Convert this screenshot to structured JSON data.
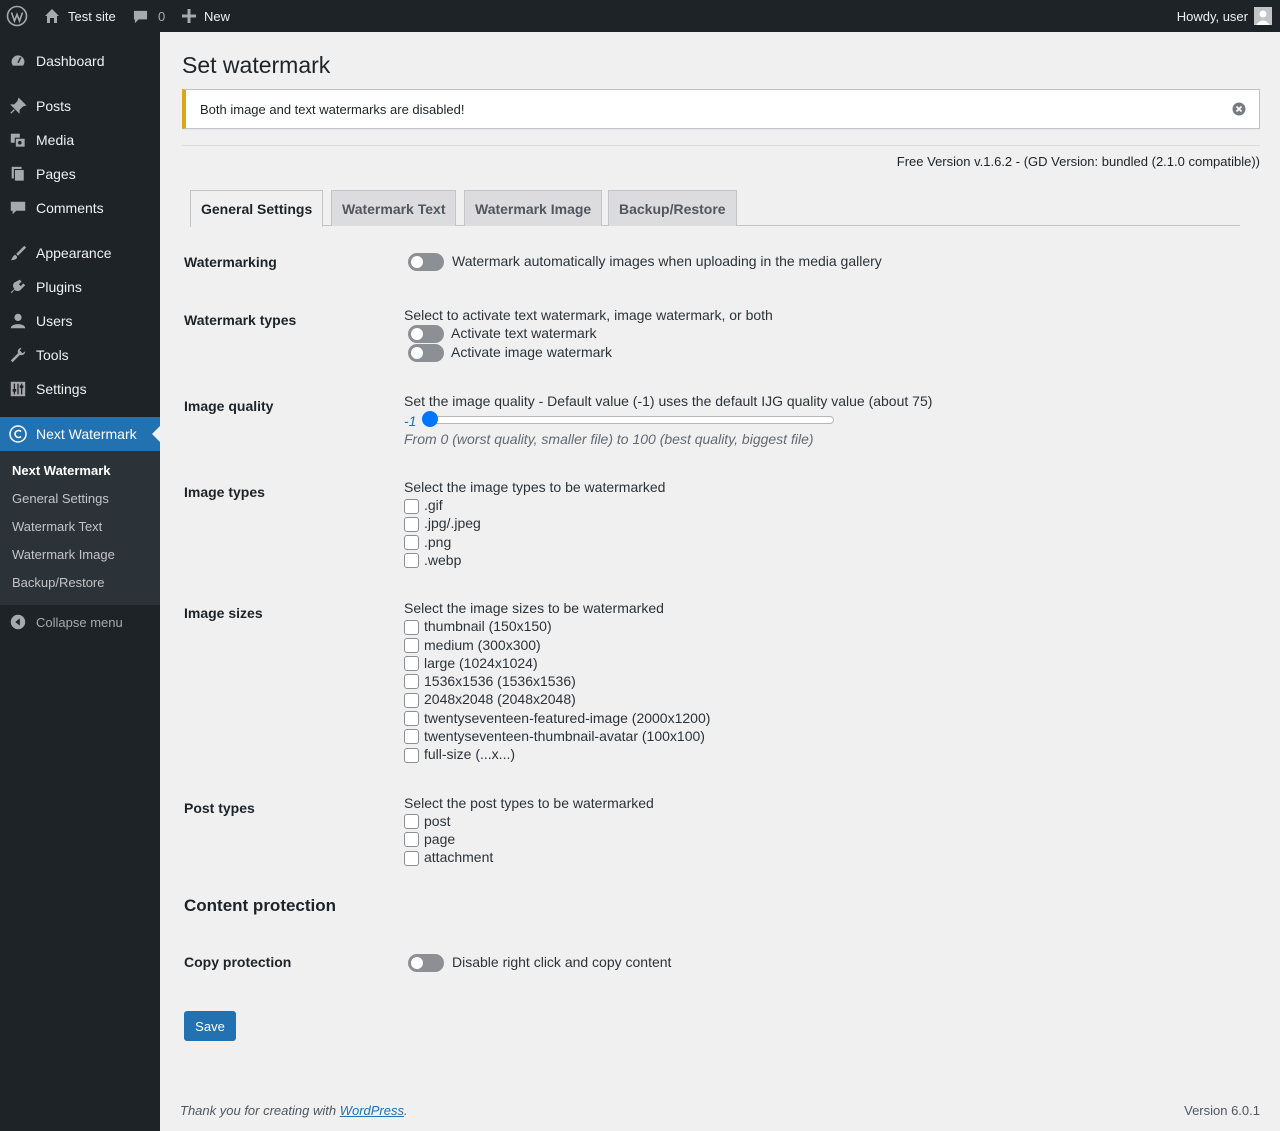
{
  "admin_bar": {
    "site_name": "Test site",
    "comments_count": "0",
    "new_label": "New",
    "howdy": "Howdy, user",
    "icons": [
      "wordpress-logo-icon",
      "home-icon",
      "comment-icon",
      "plus-icon",
      "avatar"
    ]
  },
  "sidebar": {
    "items": [
      {
        "label": "Dashboard",
        "icon": "dashboard-icon"
      },
      {
        "label": "Posts",
        "icon": "pin-icon"
      },
      {
        "label": "Media",
        "icon": "media-icon"
      },
      {
        "label": "Pages",
        "icon": "pages-icon"
      },
      {
        "label": "Comments",
        "icon": "comment-icon"
      },
      {
        "label": "Appearance",
        "icon": "brush-icon"
      },
      {
        "label": "Plugins",
        "icon": "plug-icon"
      },
      {
        "label": "Users",
        "icon": "user-icon"
      },
      {
        "label": "Tools",
        "icon": "wrench-icon"
      },
      {
        "label": "Settings",
        "icon": "sliders-icon"
      },
      {
        "label": "Next Watermark",
        "icon": "copyright-icon"
      }
    ],
    "submenu": [
      "Next Watermark",
      "General Settings",
      "Watermark Text",
      "Watermark Image",
      "Backup/Restore"
    ],
    "collapse_label": "Collapse menu"
  },
  "page": {
    "title": "Set watermark",
    "notice": "Both image and text watermarks are disabled!",
    "version_line": "Free Version v.1.6.2 - (GD Version: bundled (2.1.0 compatible))",
    "tabs": [
      "General Settings",
      "Watermark Text",
      "Watermark Image",
      "Backup/Restore"
    ],
    "active_tab": "General Settings"
  },
  "form": {
    "watermarking": {
      "label": "Watermarking",
      "toggle_label": "Watermark automatically images when uploading in the media gallery",
      "enabled": false
    },
    "watermark_types": {
      "label": "Watermark types",
      "description": "Select to activate text watermark, image watermark, or both",
      "text_label": "Activate text watermark",
      "image_label": "Activate image watermark"
    },
    "image_quality": {
      "label": "Image quality",
      "description": "Set the image quality - Default value (-1) uses the default IJG quality value (about 75)",
      "value": "-1",
      "hint": "From 0 (worst quality, smaller file) to 100 (best quality, biggest file)"
    },
    "image_types": {
      "label": "Image types",
      "description": "Select the image types to be watermarked",
      "options": [
        ".gif",
        ".jpg/.jpeg",
        ".png",
        ".webp"
      ]
    },
    "image_sizes": {
      "label": "Image sizes",
      "description": "Select the image sizes to be watermarked",
      "options": [
        "thumbnail (150x150)",
        "medium (300x300)",
        "large (1024x1024)",
        "1536x1536 (1536x1536)",
        "2048x2048 (2048x2048)",
        "twentyseventeen-featured-image (2000x1200)",
        "twentyseventeen-thumbnail-avatar (100x100)",
        "full-size (...x...)"
      ]
    },
    "post_types": {
      "label": "Post types",
      "description": "Select the post types to be watermarked",
      "options": [
        "post",
        "page",
        "attachment"
      ]
    },
    "content_protection": {
      "section_title": "Content protection",
      "label": "Copy protection",
      "toggle_label": "Disable right click and copy content"
    },
    "save_label": "Save"
  },
  "footer": {
    "thanks_prefix": "Thank you for creating with ",
    "thanks_link": "WordPress",
    "thanks_suffix": ".",
    "version": "Version 6.0.1"
  },
  "colors": {
    "admin_bar": "#1d2327",
    "accent": "#2271b1",
    "notice_warning": "#dba617"
  }
}
